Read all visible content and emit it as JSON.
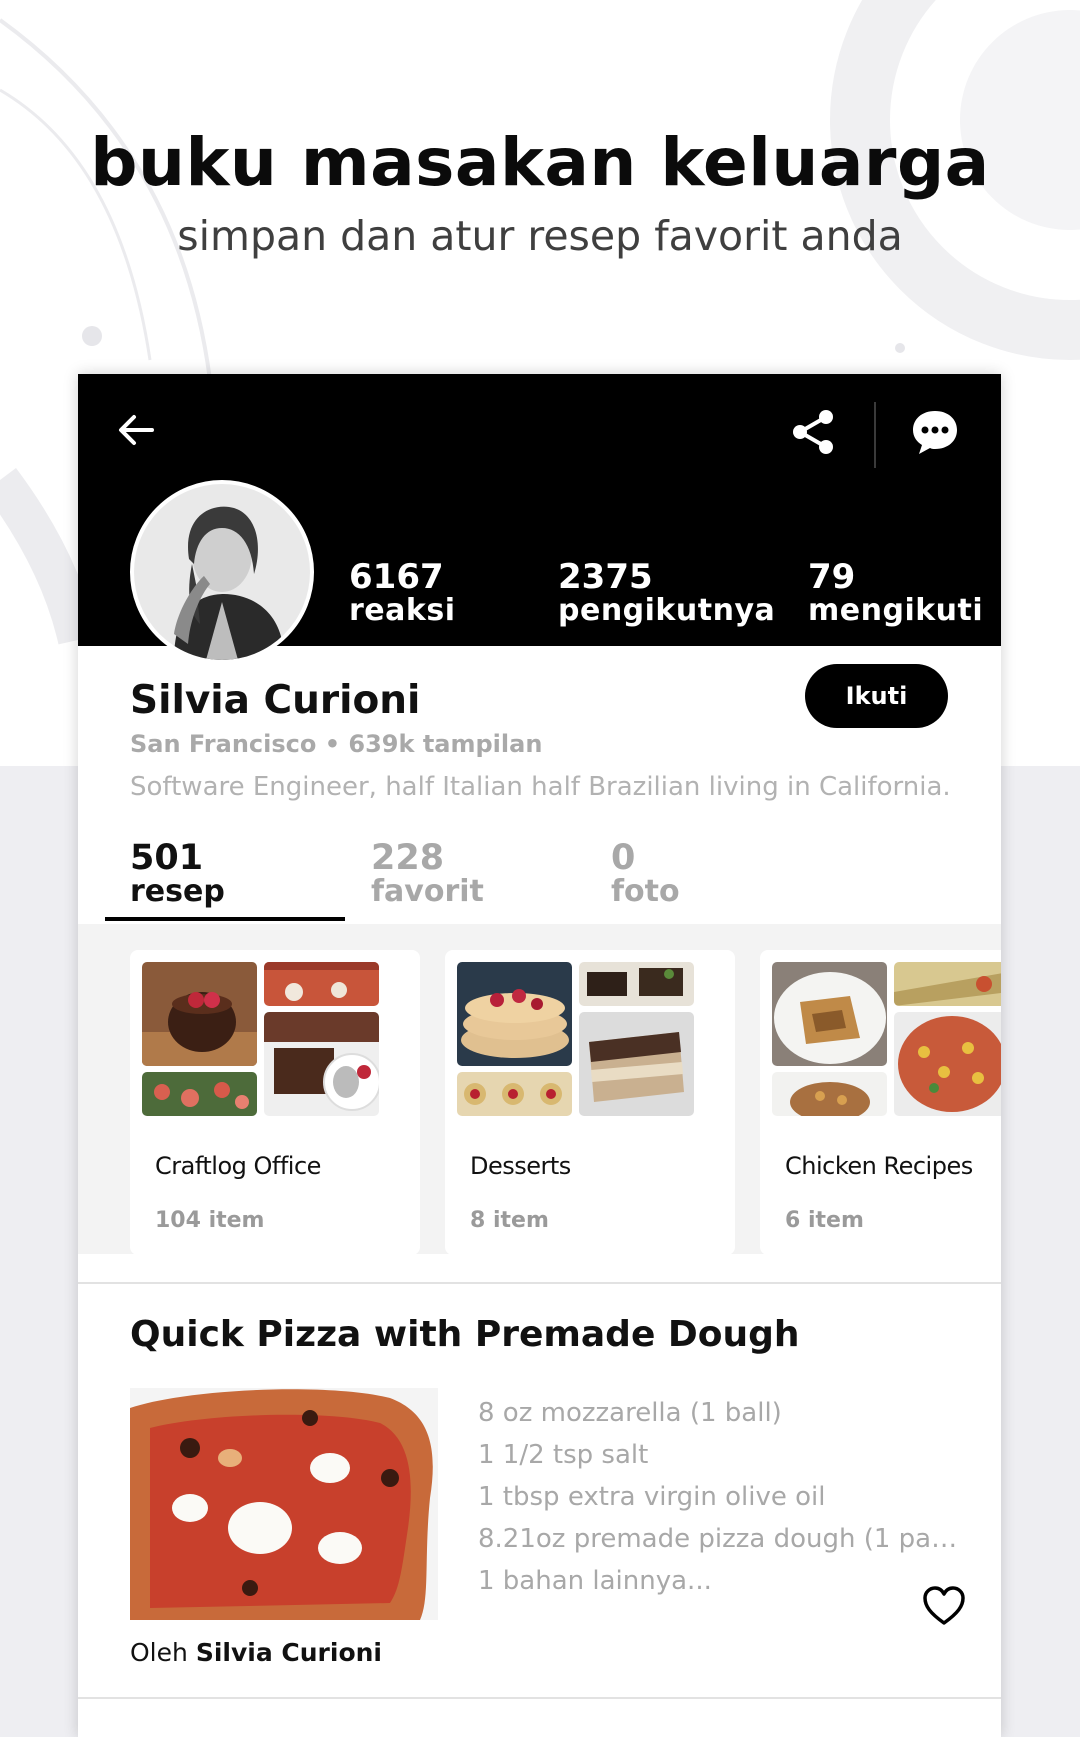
{
  "hero": {
    "title": "buku masakan keluarga",
    "subtitle": "simpan dan atur resep favorit anda"
  },
  "toolbar": {
    "back_icon": "arrow-left-icon",
    "share_icon": "share-icon",
    "chat_icon": "chat-bubble-icon"
  },
  "profile": {
    "stats": [
      {
        "value": "6167",
        "label": "reaksi"
      },
      {
        "value": "2375",
        "label": "pengikutnya"
      },
      {
        "value": "79",
        "label": "mengikuti"
      }
    ],
    "name": "Silvia Curioni",
    "meta": "San Francisco • 639k tampilan",
    "bio": "Software Engineer, half Italian half Brazilian living in California.",
    "follow_label": "Ikuti"
  },
  "tabs": [
    {
      "value": "501",
      "label": "resep",
      "active": true
    },
    {
      "value": "228",
      "label": "favorit",
      "active": false
    },
    {
      "value": "0",
      "label": "foto",
      "active": false
    }
  ],
  "collections": [
    {
      "title": "Craftlog Office",
      "count": "104 item"
    },
    {
      "title": "Desserts",
      "count": "8 item"
    },
    {
      "title": "Chicken Recipes",
      "count": "6 item"
    }
  ],
  "recipe": {
    "title": "Quick Pizza with Premade Dough",
    "ingredients": [
      "8 oz mozzarella  (1 ball)",
      "1 1/2 tsp salt",
      "1 tbsp extra virgin olive oil",
      "8.21oz premade pizza dough (1 pa…",
      "1 bahan lainnya..."
    ],
    "author_prefix": "Oleh",
    "author_name": "Silvia Curioni",
    "heart_icon": "heart-outline-icon"
  },
  "colors": {
    "header_bg": "#000000",
    "accent": "#000000",
    "muted_text": "#a8a8a8",
    "page_bg_lower": "#eeeef2"
  }
}
